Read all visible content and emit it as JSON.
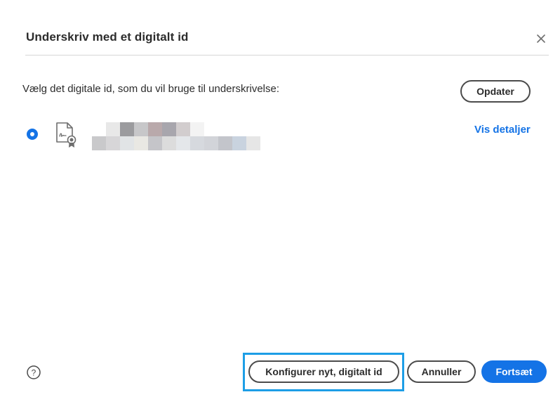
{
  "dialog": {
    "title": "Underskriv med et digitalt id",
    "close_icon": "close-icon"
  },
  "body": {
    "prompt": "Vælg det digitale id, som du vil bruge til underskrivelse:",
    "update_label": "Opdater",
    "digital_ids": [
      {
        "selected": true,
        "icon": "certificate-document-icon",
        "details_label": "Vis detaljer"
      }
    ]
  },
  "footer": {
    "help_icon": "help-icon",
    "configure_label": "Konfigurer nyt, digitalt id",
    "cancel_label": "Annuller",
    "continue_label": "Fortsæt"
  },
  "colors": {
    "accent": "#1473e6",
    "focus_highlight": "#1d9ee6",
    "text": "#2c2c2c",
    "divider": "#d6d6d6"
  }
}
